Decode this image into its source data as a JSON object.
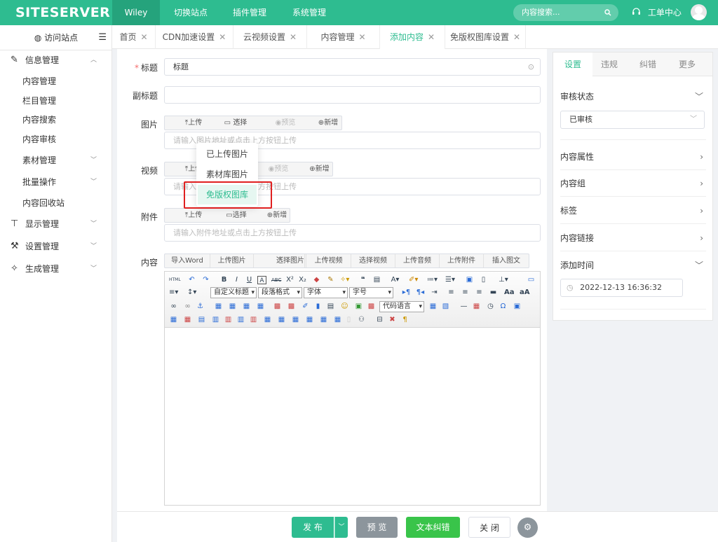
{
  "header": {
    "logo": "SITESERVER",
    "site_name": "Wiley",
    "nav": [
      "切换站点",
      "插件管理",
      "系统管理"
    ],
    "search_placeholder": "内容搜索...",
    "help_label": "工单中心",
    "colors": {
      "brand": "#2ebc90",
      "brand_dark": "#25a37c"
    }
  },
  "sidebar": {
    "visit_label": "访问站点",
    "groups": [
      {
        "label": "信息管理",
        "icon": "edit-icon",
        "expanded": true
      },
      {
        "label": "显示管理",
        "icon": "shirt-icon"
      },
      {
        "label": "设置管理",
        "icon": "wrench-icon"
      },
      {
        "label": "生成管理",
        "icon": "magic-wand-icon"
      }
    ],
    "items": [
      "内容管理",
      "栏目管理",
      "内容搜索",
      "内容审核",
      "素材管理",
      "批量操作",
      "内容回收站"
    ]
  },
  "tabs": [
    {
      "label": "首页"
    },
    {
      "label": "CDN加速设置"
    },
    {
      "label": "云视频设置"
    },
    {
      "label": "内容管理"
    },
    {
      "label": "添加内容",
      "active": true
    },
    {
      "label": "免版权图库设置"
    }
  ],
  "form": {
    "title_label": "标题",
    "title_value": "标题",
    "subtitle_label": "副标题",
    "image_label": "图片",
    "video_label": "视频",
    "attachment_label": "附件",
    "content_label": "内容",
    "upload": "上传",
    "select": "选择",
    "preview": "预览",
    "add": "新增",
    "image_placeholder": "请输入图片地址或点击上方按钮上传",
    "video_placeholder": "请输入视频地址或点击上方按钮上传",
    "attachment_placeholder": "请输入附件地址或点击上方按钮上传",
    "content_tools": [
      "导入Word",
      "上传图片",
      "选择图片",
      "上传视频",
      "选择视频",
      "上传音频",
      "上传附件",
      "插入图文"
    ],
    "editor_selects": {
      "custom_title": "自定义标题",
      "paragraph": "段落格式",
      "font": "字体",
      "font_size": "字号",
      "code_lang": "代码语言"
    }
  },
  "dropdown": {
    "items": [
      "已上传图片",
      "素材库图片",
      "免版权图库"
    ],
    "highlighted": "免版权图库"
  },
  "right_panel": {
    "tabs": [
      "设置",
      "违规",
      "纠错",
      "更多"
    ],
    "audit_label": "审核状态",
    "audit_value": "已审核",
    "rows": [
      "内容属性",
      "内容组",
      "标签",
      "内容链接"
    ],
    "time_label": "添加时间",
    "time_value": "2022-12-13 16:36:32"
  },
  "footer": {
    "publish": "发 布",
    "preview": "预 览",
    "correct": "文本纠错",
    "close": "关 闭"
  }
}
